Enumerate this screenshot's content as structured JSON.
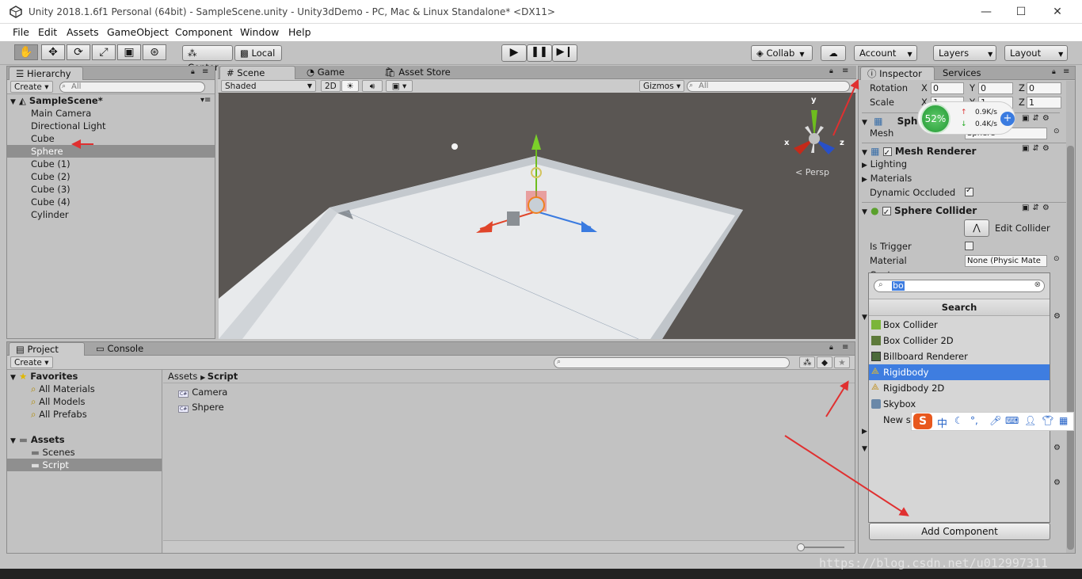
{
  "window": {
    "title": "Unity 2018.1.6f1 Personal (64bit) - SampleScene.unity - Unity3dDemo - PC, Mac & Linux Standalone* <DX11>",
    "minimize": "—",
    "maximize": "☐",
    "close": "✕"
  },
  "menu": [
    "File",
    "Edit",
    "Assets",
    "GameObject",
    "Component",
    "Window",
    "Help"
  ],
  "toolbar": {
    "pivot": "Center",
    "space": "Local",
    "collab": "Collab",
    "account": "Account",
    "layers": "Layers",
    "layout": "Layout"
  },
  "hierarchy": {
    "tab": "Hierarchy",
    "create": "Create",
    "search_placeholder": "All",
    "scene": "SampleScene*",
    "items": [
      "Main Camera",
      "Directional Light",
      "Cube",
      "Sphere",
      "Cube (1)",
      "Cube (2)",
      "Cube (3)",
      "Cube (4)",
      "Cylinder"
    ],
    "selected": "Sphere"
  },
  "scene_view": {
    "tabs": [
      "Scene",
      "Game",
      "Asset Store"
    ],
    "shading": "Shaded",
    "mode_2d": "2D",
    "gizmos": "Gizmos",
    "search_placeholder": "All",
    "persp": "Persp",
    "axis_x": "x",
    "axis_y": "y",
    "axis_z": "z"
  },
  "project": {
    "tabs": [
      "Project",
      "Console"
    ],
    "create": "Create",
    "favorites_label": "Favorites",
    "favorites": [
      "All Materials",
      "All Models",
      "All Prefabs"
    ],
    "assets_label": "Assets",
    "folders": [
      "Scenes",
      "Script"
    ],
    "breadcrumb_root": "Assets",
    "breadcrumb_current": "Script",
    "files": [
      "Camera",
      "Shpere"
    ],
    "file_badge": "C#"
  },
  "inspector": {
    "tabs": [
      "Inspector",
      "Services"
    ],
    "rotation_label": "Rotation",
    "rotation": {
      "x": "0",
      "y": "0",
      "z": "0"
    },
    "scale_label": "Scale",
    "scale": {
      "x": "1",
      "y": "1",
      "z": "1"
    },
    "axis_x": "X",
    "axis_y": "Y",
    "axis_z": "Z",
    "mesh_filter_title": "Sphe",
    "mesh_label": "Mesh",
    "mesh_value": "Sphere",
    "mesh_renderer_title": "Mesh Renderer",
    "lighting": "Lighting",
    "materials": "Materials",
    "dynamic_occluded": "Dynamic Occluded",
    "sphere_collider_title": "Sphere Collider",
    "edit_collider": "Edit Collider",
    "is_trigger": "Is Trigger",
    "material_label": "Material",
    "material_value": "None (Physic Mate",
    "center_label": "Center",
    "add_component": "Add Component"
  },
  "add_component": {
    "search_value": "bo",
    "header": "Search",
    "items": [
      "Box Collider",
      "Box Collider 2D",
      "Billboard Renderer",
      "Rigidbody",
      "Rigidbody 2D",
      "Skybox",
      "New sc"
    ],
    "selected": "Rigidbody"
  },
  "net_widget": {
    "percent": "52%",
    "up": "0.9K/s",
    "down": "0.4K/s"
  },
  "ime": {
    "lang": "中"
  },
  "watermark": "https://blog.csdn.net/u012997311",
  "colors": {
    "selection": "#3e7de0",
    "annotation": "#e03030",
    "scene_bg": "#5a5653"
  }
}
